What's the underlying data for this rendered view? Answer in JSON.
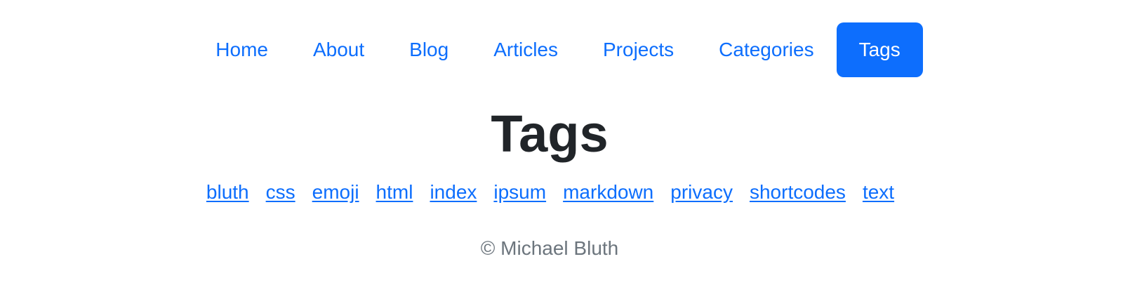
{
  "nav": {
    "items": [
      {
        "label": "Home"
      },
      {
        "label": "About"
      },
      {
        "label": "Blog"
      },
      {
        "label": "Articles"
      },
      {
        "label": "Projects"
      },
      {
        "label": "Categories"
      },
      {
        "label": "Tags",
        "active": true
      }
    ],
    "active_color": "#0d6efd"
  },
  "page": {
    "title": "Tags"
  },
  "tags": [
    {
      "label": "bluth"
    },
    {
      "label": "css"
    },
    {
      "label": "emoji"
    },
    {
      "label": "html"
    },
    {
      "label": "index"
    },
    {
      "label": "ipsum"
    },
    {
      "label": "markdown"
    },
    {
      "label": "privacy"
    },
    {
      "label": "shortcodes"
    },
    {
      "label": "text"
    }
  ],
  "footer": {
    "copyright": "© Michael Bluth"
  },
  "colors": {
    "link": "#0d6efd",
    "heading": "#212529",
    "muted": "#6c757d"
  }
}
